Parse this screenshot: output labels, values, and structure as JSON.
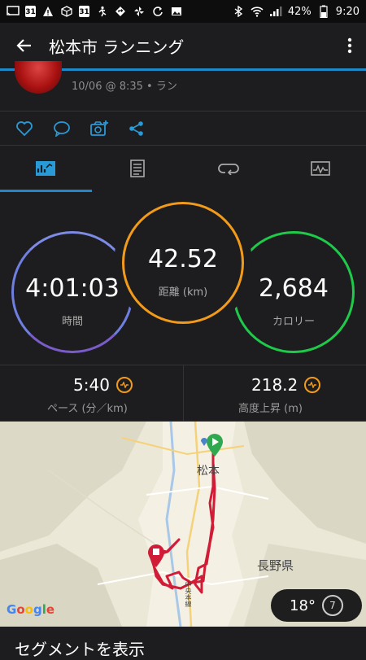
{
  "status_bar": {
    "battery": "42%",
    "time": "9:20",
    "calendar_day": "31"
  },
  "app_bar": {
    "title": "松本市 ランニング"
  },
  "activity": {
    "meta": "10/06 @ 8:35 • ラン"
  },
  "tabs": [
    {
      "name": "stats",
      "active": true
    },
    {
      "name": "notes",
      "active": false
    },
    {
      "name": "laps",
      "active": false
    },
    {
      "name": "charts",
      "active": false
    }
  ],
  "stats": {
    "time": {
      "value": "4:01:03",
      "label": "時間"
    },
    "distance": {
      "value": "42.52",
      "label": "距離 (km)"
    },
    "calories": {
      "value": "2,684",
      "label": "カロリー"
    },
    "pace": {
      "value": "5:40",
      "label": "ペース (分／km)"
    },
    "elevation": {
      "value": "218.2",
      "label": "高度上昇 (m)"
    }
  },
  "map": {
    "city_label": "松本",
    "prefecture_label": "長野県",
    "highway_label": "中央本線",
    "attribution": "Google",
    "temperature": "18°",
    "wind": "7"
  },
  "segment": {
    "label": "セグメントを表示"
  },
  "colors": {
    "time_ring": "#6f7fe0",
    "distance_ring": "#f29a1a",
    "calories_ring": "#1fc94a",
    "accent": "#1e88c8",
    "route": "#d01c36"
  }
}
